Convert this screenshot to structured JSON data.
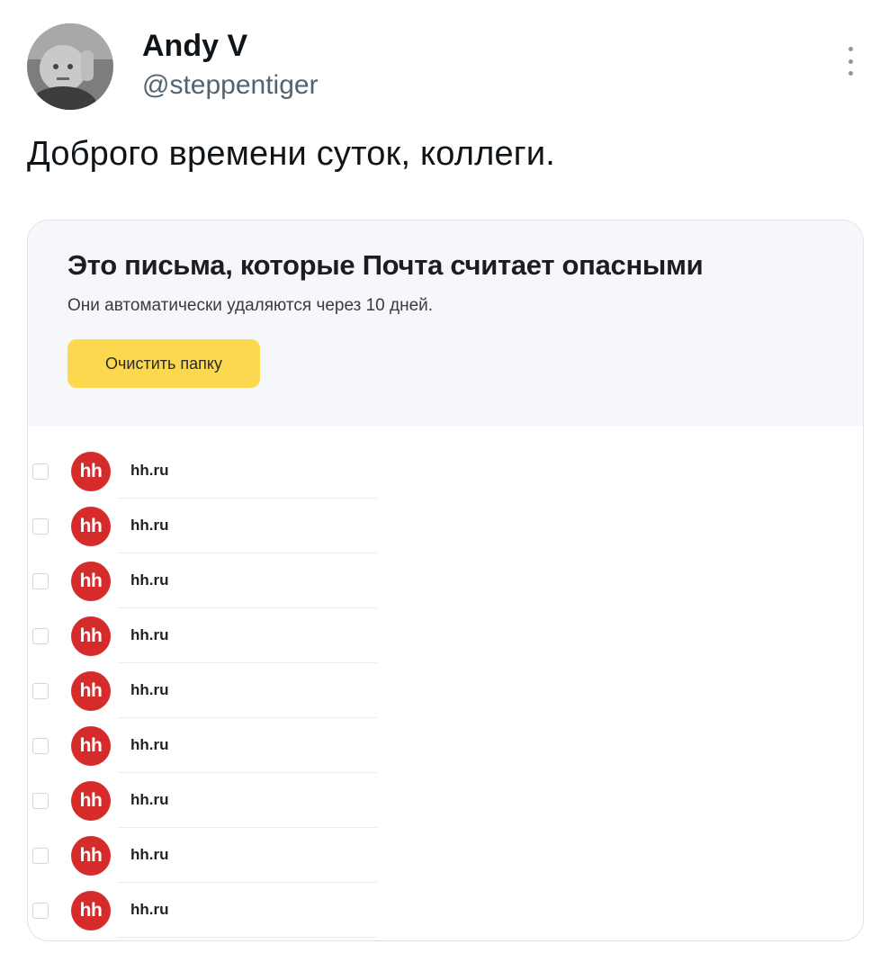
{
  "tweet": {
    "author_name": "Andy V",
    "author_handle": "@steppentiger",
    "text": "Доброго времени суток, коллеги."
  },
  "mail": {
    "title": "Это письма, которые Почта считает опасными",
    "subtitle": "Они автоматически удаляются через 10 дней.",
    "clear_button_label": "Очистить папку",
    "accent_color": "#fcd84e",
    "messages": [
      {
        "logo": "hh",
        "sender": "hh.ru"
      },
      {
        "logo": "hh",
        "sender": "hh.ru"
      },
      {
        "logo": "hh",
        "sender": "hh.ru"
      },
      {
        "logo": "hh",
        "sender": "hh.ru"
      },
      {
        "logo": "hh",
        "sender": "hh.ru"
      },
      {
        "logo": "hh",
        "sender": "hh.ru"
      },
      {
        "logo": "hh",
        "sender": "hh.ru"
      },
      {
        "logo": "hh",
        "sender": "hh.ru"
      },
      {
        "logo": "hh",
        "sender": "hh.ru"
      }
    ],
    "logo_color": "#d52b2b"
  }
}
